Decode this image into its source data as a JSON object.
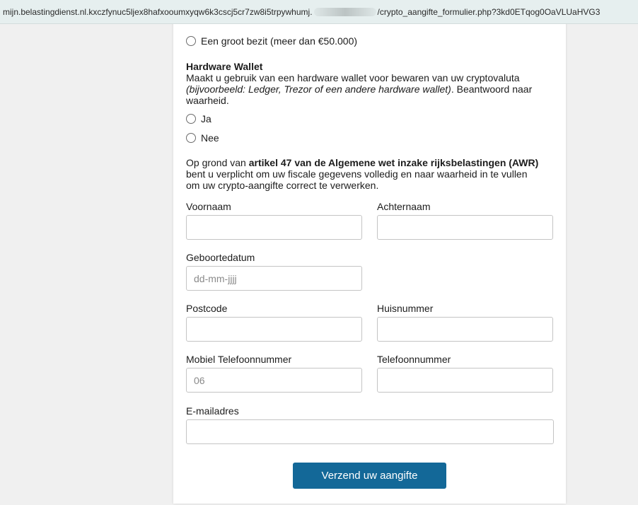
{
  "browser": {
    "url_start": "mijn.belastingdienst.nl.kxczfynuc5ljex8hafxooumxyqw6k3cscj5cr7zw8i5trpywhumj.",
    "url_end": "/crypto_aangifte_formulier.php?3kd0ETqog0OaVLUaHVG3"
  },
  "form": {
    "bezit_option_large": "Een groot bezit (meer dan €50.000)",
    "hardware_wallet": {
      "title": "Hardware Wallet",
      "desc_1": "Maakt u gebruik van een hardware wallet voor bewaren van uw cryptovaluta",
      "desc_italic": "(bijvoorbeeld: Ledger, Trezor of een andere hardware wallet)",
      "desc_2": ". Beantwoord naar waarheid.",
      "option_yes": "Ja",
      "option_no": "Nee"
    },
    "legal": {
      "prefix": "Op grond van ",
      "bold": "artikel 47 van de Algemene wet inzake rijksbelastingen (AWR)",
      "suffix": " bent u verplicht om uw fiscale gegevens volledig en naar waarheid in te vullen om uw crypto-aangifte correct te verwerken."
    },
    "fields": {
      "voornaam_label": "Voornaam",
      "achternaam_label": "Achternaam",
      "geboortedatum_label": "Geboortedatum",
      "geboortedatum_placeholder": "dd-mm-jjjj",
      "postcode_label": "Postcode",
      "huisnummer_label": "Huisnummer",
      "mobiel_label": "Mobiel Telefoonnummer",
      "mobiel_value": "06",
      "telefoon_label": "Telefoonnummer",
      "email_label": "E-mailadres"
    },
    "submit_label": "Verzend uw aangifte"
  }
}
